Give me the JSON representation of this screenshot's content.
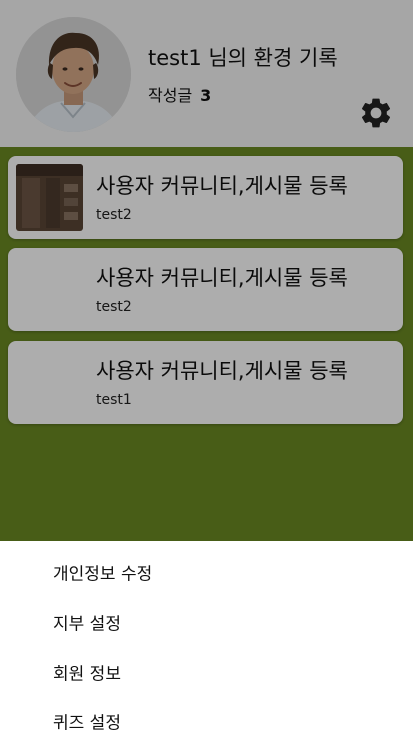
{
  "profile": {
    "title": "test1 님의 환경 기록",
    "post_count_label": "작성글",
    "post_count": "3",
    "avatar_icon": "avatar-photo",
    "settings_icon": "gear-icon"
  },
  "feed": {
    "posts": [
      {
        "title": "사용자 커뮤니티,게시물 등록",
        "author": "test2",
        "has_thumbnail": true
      },
      {
        "title": "사용자 커뮤니티,게시물 등록",
        "author": "test2",
        "has_thumbnail": false
      },
      {
        "title": "사용자 커뮤니티,게시물 등록",
        "author": "test1",
        "has_thumbnail": false
      }
    ]
  },
  "bottom_sheet": {
    "items": [
      {
        "label": "개인정보 수정"
      },
      {
        "label": "지부 설정"
      },
      {
        "label": "회원 정보"
      },
      {
        "label": "퀴즈 설정"
      }
    ]
  },
  "colors": {
    "feed_background": "#6b8a23",
    "header_background": "#f5f5f5",
    "sheet_background": "#ffffff"
  }
}
